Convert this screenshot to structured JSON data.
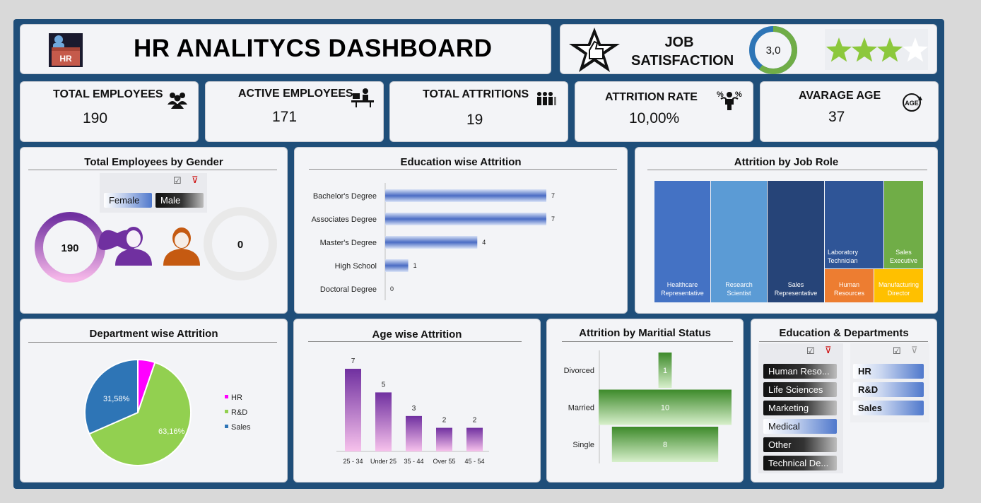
{
  "header": {
    "title": "HR ANALITYCS DASHBOARD",
    "logo_text": "HR"
  },
  "job_satisfaction": {
    "label_line1": "JOB",
    "label_line2": "SATISFACTION",
    "score": "3,0",
    "score_fraction": 0.6,
    "stars_filled": 3,
    "stars_total": 4
  },
  "kpis": [
    {
      "label": "TOTAL EMPLOYEES",
      "value": "190",
      "icon": "people-group-icon"
    },
    {
      "label": "ACTIVE EMPLOYEES",
      "value": "171",
      "icon": "person-at-desk-icon"
    },
    {
      "label": "TOTAL ATTRITIONS",
      "value": "19",
      "icon": "people-leaving-icon"
    },
    {
      "label": "ATTRITION RATE",
      "value": "10,00%",
      "icon": "percent-person-icon"
    },
    {
      "label": "AVARAGE AGE",
      "value": "37",
      "icon": "age-icon"
    }
  ],
  "gender": {
    "title": "Total Employees by Gender",
    "buttons": [
      "Female",
      "Male"
    ],
    "female_value": "190",
    "male_value": "0",
    "female_fraction": 1,
    "male_fraction": 0
  },
  "education_attrition": {
    "title": "Education wise Attrition",
    "chart_data": {
      "type": "bar",
      "orientation": "horizontal",
      "categories": [
        "Bachelor's Degree",
        "Associates Degree",
        "Master's Degree",
        "High School",
        "Doctoral Degree"
      ],
      "values": [
        7,
        7,
        4,
        1,
        0
      ],
      "xlim": [
        0,
        7
      ]
    }
  },
  "job_role": {
    "title": "Attrition by Job Role",
    "chart_data": {
      "type": "treemap",
      "items": [
        {
          "label": "Healthcare Representative",
          "value": 4,
          "color": "#4472c4"
        },
        {
          "label": "Research Scientist",
          "value": 4,
          "color": "#5b9bd5"
        },
        {
          "label": "Sales Representative",
          "value": 4,
          "color": "#264478"
        },
        {
          "label": "Laboratory Technician",
          "value": 2,
          "color": "#2f5597"
        },
        {
          "label": "Sales Executive",
          "value": 1,
          "color": "#70ad47"
        },
        {
          "label": "Human Resources",
          "value": 2,
          "color": "#ed7d31"
        },
        {
          "label": "Manufacturing Director",
          "value": 2,
          "color": "#ffc000"
        }
      ]
    }
  },
  "department": {
    "title": "Department wise Attrition",
    "chart_data": {
      "type": "pie",
      "slices": [
        {
          "name": "HR",
          "value": 5.26,
          "label": "5,26%",
          "color": "#ff00ff"
        },
        {
          "name": "R&D",
          "value": 63.16,
          "label": "63,16%",
          "color": "#92d050"
        },
        {
          "name": "Sales",
          "value": 31.58,
          "label": "31,58%",
          "color": "#2e75b6"
        }
      ],
      "legend": "right"
    }
  },
  "age": {
    "title": "Age wise Attrition",
    "chart_data": {
      "type": "bar",
      "categories": [
        "25 - 34",
        "Under 25",
        "35 - 44",
        "Over 55",
        "45 - 54"
      ],
      "values": [
        7,
        5,
        3,
        2,
        2
      ],
      "ylim": [
        0,
        7
      ]
    }
  },
  "marital": {
    "title": "Attrition by Maritial Status",
    "chart_data": {
      "type": "bar",
      "orientation": "horizontal-centered",
      "categories": [
        "Divorced",
        "Married",
        "Single"
      ],
      "values": [
        1,
        10,
        8
      ]
    }
  },
  "edu_dept": {
    "title": "Education & Departments",
    "education": [
      "Human Reso...",
      "Life Sciences",
      "Marketing",
      "Medical",
      "Other",
      "Technical De..."
    ],
    "selected_education": "Medical",
    "departments": [
      "HR",
      "R&D",
      "Sales"
    ]
  }
}
